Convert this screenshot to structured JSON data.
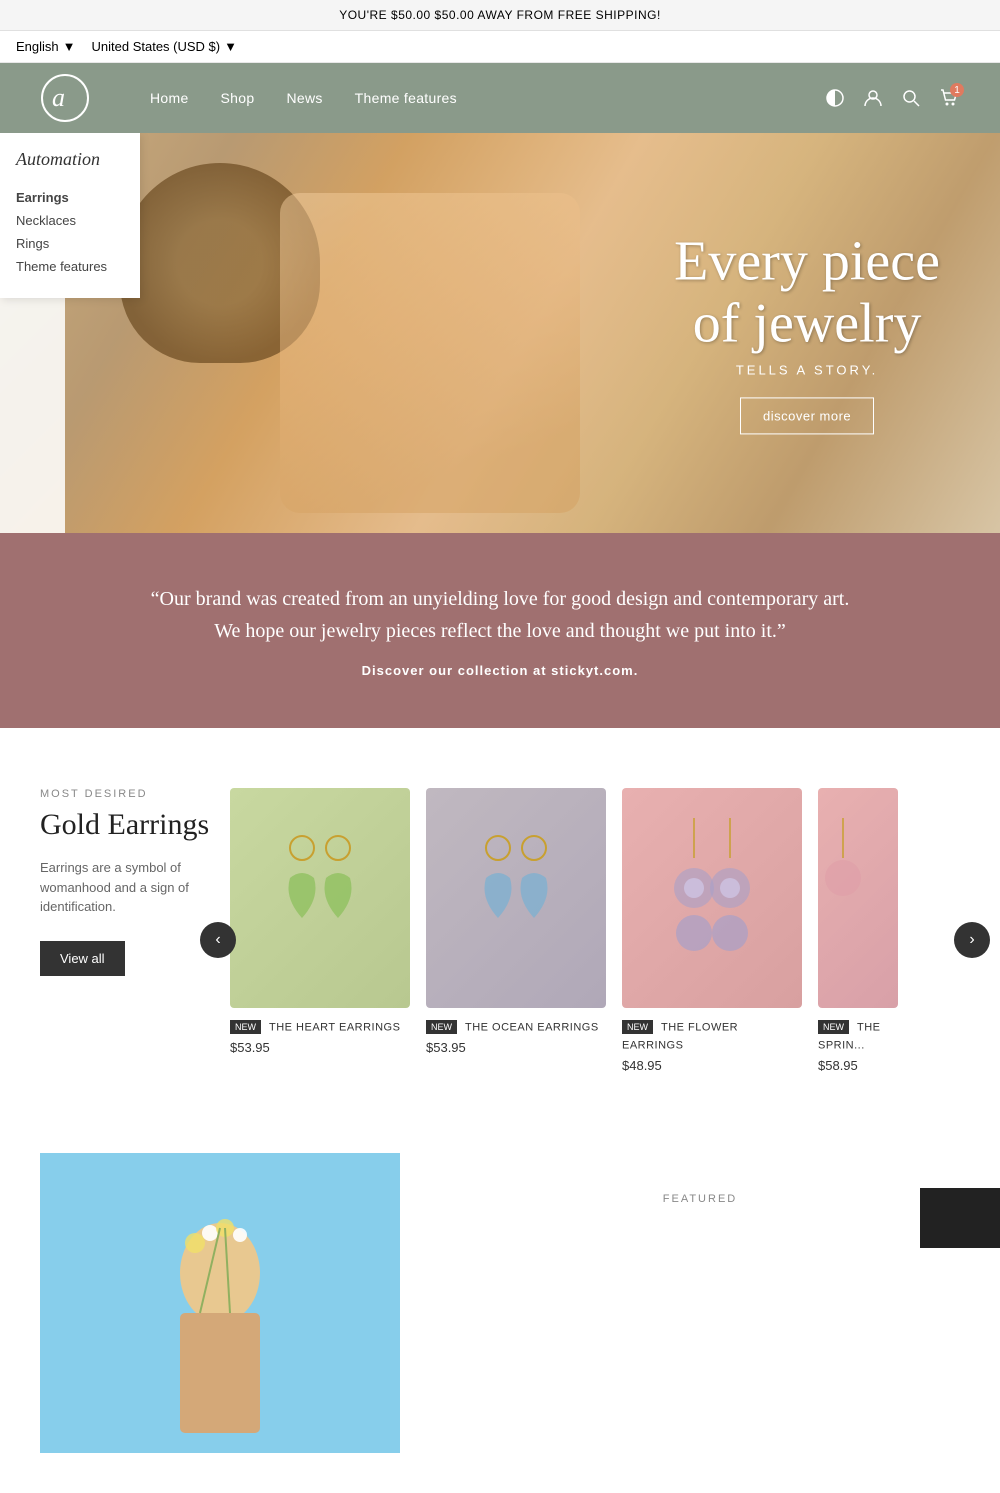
{
  "announcement": {
    "text": "YOU'RE $50.00 $50.00 AWAY FROM FREE SHIPPING!"
  },
  "locale": {
    "language": "English",
    "region": "United States (USD $)"
  },
  "nav": {
    "links": [
      {
        "label": "Home",
        "href": "#"
      },
      {
        "label": "Shop",
        "href": "#"
      },
      {
        "label": "News",
        "href": "#"
      },
      {
        "label": "Theme features",
        "href": "#"
      }
    ],
    "cart_count": "1"
  },
  "dropdown": {
    "brand": "Automation",
    "items": [
      {
        "label": "Earrings",
        "active": true
      },
      {
        "label": "Necklaces"
      },
      {
        "label": "Rings"
      },
      {
        "label": "Theme features"
      }
    ]
  },
  "hero": {
    "heading_line1": "Every piece",
    "heading_line2": "of jewelry",
    "subtitle": "TELLS A STORY.",
    "button_label": "discover more"
  },
  "quote": {
    "text": "“Our brand was created from an unyielding love for good design and contemporary art.\nWe hope our jewelry pieces reflect the love and thought we put into it.”",
    "cta": "Discover our collection at stickyt.com."
  },
  "products": {
    "label": "MOST DESIRED",
    "heading": "Gold Earrings",
    "description": "Earrings are a symbol of womanhood and a sign of identification.",
    "view_all": "View all",
    "items": [
      {
        "badge": "NEW",
        "name": "THE HEART EARRINGS",
        "price": "$53.95",
        "bg": "heart"
      },
      {
        "badge": "NEW",
        "name": "THE OCEAN EARRINGS",
        "price": "$53.95",
        "bg": "ocean"
      },
      {
        "badge": "NEW",
        "name": "THE FLOWER EARRINGS",
        "price": "$48.95",
        "bg": "flower"
      },
      {
        "badge": "NEW",
        "name": "THE SPRIN...",
        "price": "$58.95",
        "bg": "spring"
      }
    ]
  },
  "bottom": {
    "featured_label": "FEATURED"
  }
}
